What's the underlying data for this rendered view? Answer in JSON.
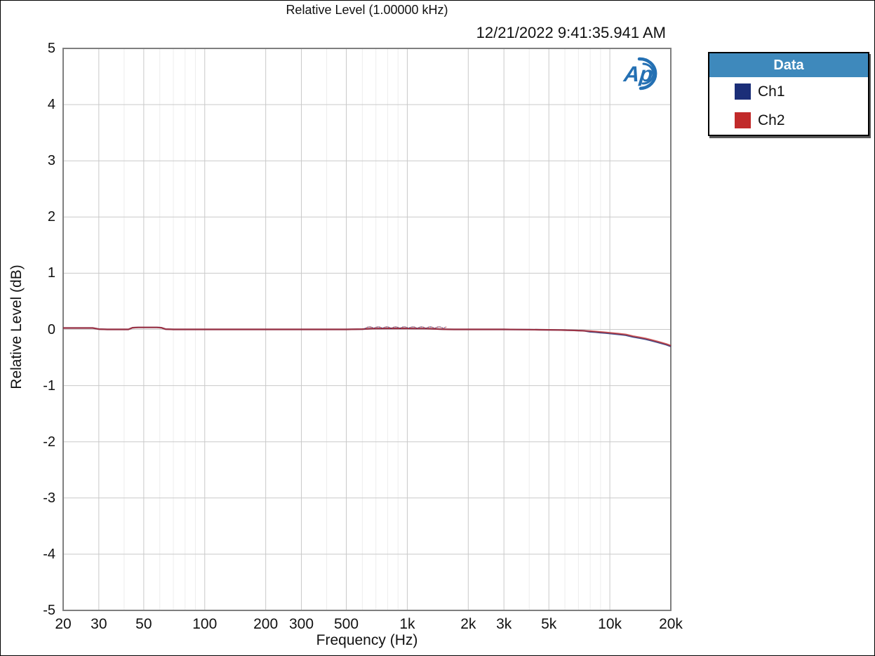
{
  "header": {
    "title": "Relative Level (1.00000 kHz)",
    "timestamp": "12/21/2022 9:41:35.941 AM"
  },
  "logo": {
    "name": "Audio Precision",
    "text": "Ap",
    "color": "#2470b3"
  },
  "legend": {
    "header": "Data",
    "header_bg": "#3e89bc",
    "header_color": "#ffffff",
    "entries": [
      {
        "label": "Ch1",
        "color": "#1b2e78"
      },
      {
        "label": "Ch2",
        "color": "#c12a2a"
      }
    ]
  },
  "plot": {
    "bg": "#ffffff",
    "frame_color": "#7f7f7f",
    "major_grid_color": "#c9c9c9",
    "minor_grid_color": "#ededed"
  },
  "chart_data": {
    "type": "line",
    "title": "Relative Level (1.00000 kHz)",
    "xlabel": "Frequency (Hz)",
    "ylabel": "Relative Level (dB)",
    "x_scale": "log",
    "xlim": [
      20,
      20000
    ],
    "ylim": [
      -5,
      5
    ],
    "grid": true,
    "legend_position": "outside-top-right",
    "y_ticks": [
      5,
      4,
      3,
      2,
      1,
      0,
      -1,
      -2,
      -3,
      -4,
      -5
    ],
    "x_major_ticks": [
      {
        "value": 20,
        "label": "20"
      },
      {
        "value": 30,
        "label": "30"
      },
      {
        "value": 50,
        "label": "50"
      },
      {
        "value": 100,
        "label": "100"
      },
      {
        "value": 200,
        "label": "200"
      },
      {
        "value": 300,
        "label": "300"
      },
      {
        "value": 500,
        "label": "500"
      },
      {
        "value": 1000,
        "label": "1k"
      },
      {
        "value": 2000,
        "label": "2k"
      },
      {
        "value": 3000,
        "label": "3k"
      },
      {
        "value": 5000,
        "label": "5k"
      },
      {
        "value": 10000,
        "label": "10k"
      },
      {
        "value": 20000,
        "label": "20k"
      }
    ],
    "x_minor_ticks": [
      40,
      60,
      70,
      80,
      90,
      400,
      600,
      700,
      800,
      900,
      4000,
      6000,
      7000,
      8000,
      9000
    ],
    "x": [
      20,
      26,
      28,
      30,
      33,
      42,
      44,
      47,
      58,
      61,
      64,
      70,
      100,
      150,
      200,
      300,
      400,
      500,
      600,
      650,
      700,
      800,
      900,
      1000,
      1100,
      1200,
      1300,
      1400,
      1500,
      1700,
      2000,
      2500,
      3000,
      3500,
      4000,
      4500,
      5000,
      5500,
      6000,
      6500,
      7000,
      7500,
      8000,
      8500,
      9000,
      9500,
      10000,
      11000,
      12000,
      13000,
      14000,
      15000,
      16000,
      17000,
      18000,
      19000,
      20000
    ],
    "series": [
      {
        "name": "Ch1",
        "color": "#1b2e78",
        "y": [
          0.025,
          0.025,
          0.025,
          0.005,
          0,
          0,
          0.03,
          0.035,
          0.035,
          0.03,
          0.005,
          0,
          0,
          0,
          0,
          0,
          0,
          0,
          0.005,
          0.012,
          0.015,
          0.018,
          0.018,
          0.018,
          0.015,
          0.015,
          0.012,
          0.008,
          0.003,
          0,
          0,
          0,
          0,
          -0.002,
          -0.004,
          -0.006,
          -0.008,
          -0.01,
          -0.012,
          -0.016,
          -0.02,
          -0.025,
          -0.042,
          -0.049,
          -0.057,
          -0.064,
          -0.072,
          -0.087,
          -0.103,
          -0.133,
          -0.153,
          -0.173,
          -0.198,
          -0.223,
          -0.248,
          -0.272,
          -0.302
        ]
      },
      {
        "name": "Ch2",
        "color": "#c12a2a",
        "y": [
          0.025,
          0.025,
          0.025,
          0.005,
          0,
          0,
          0.03,
          0.035,
          0.035,
          0.03,
          0.005,
          0,
          0,
          0,
          0,
          0,
          0,
          0,
          0.005,
          0.012,
          0.015,
          0.018,
          0.018,
          0.018,
          0.015,
          0.015,
          0.012,
          0.008,
          0.003,
          0,
          0,
          0,
          0,
          -0.002,
          -0.004,
          -0.006,
          -0.008,
          -0.01,
          -0.012,
          -0.016,
          -0.02,
          -0.025,
          -0.03,
          -0.037,
          -0.045,
          -0.052,
          -0.06,
          -0.075,
          -0.09,
          -0.12,
          -0.14,
          -0.16,
          -0.185,
          -0.21,
          -0.235,
          -0.26,
          -0.29
        ]
      }
    ],
    "ripple_region": {
      "x_start": 620,
      "x_end": 1550,
      "y_level": 0.018,
      "note": "dense measurement point scatter just above trace"
    }
  }
}
